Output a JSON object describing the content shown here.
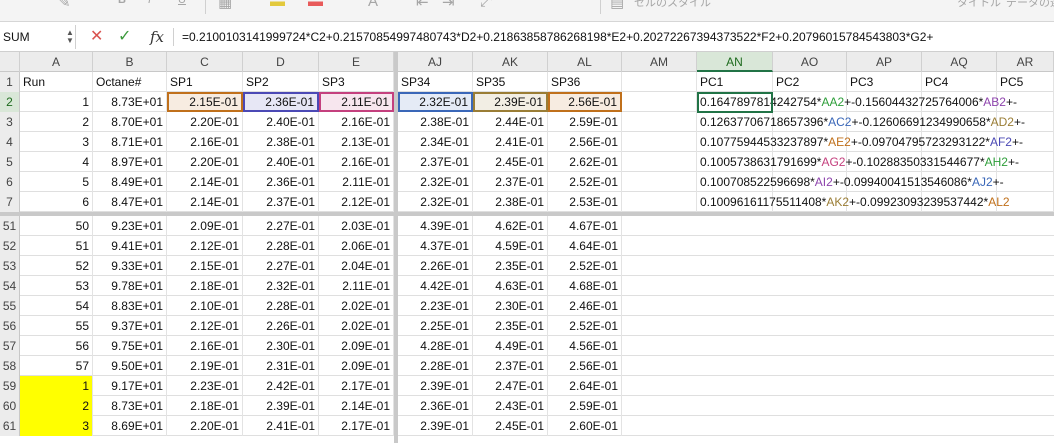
{
  "ribbon": {
    "cell_style_label": "セルのスタイル",
    "title_label": "タイトル",
    "data_label": "データの選"
  },
  "formula_bar": {
    "name_box": "SUM",
    "formula": "=0.2100103141999724*C2+0.21570854997480743*D2+0.21863858786268198*E2+0.20272267394373522*F2+0.20796015784543803*G2+"
  },
  "columns": [
    {
      "key": "A",
      "label": "A"
    },
    {
      "key": "B",
      "label": "B"
    },
    {
      "key": "C",
      "label": "C"
    },
    {
      "key": "D",
      "label": "D"
    },
    {
      "key": "E",
      "label": "E"
    },
    {
      "key": "AJ",
      "label": "AJ"
    },
    {
      "key": "AK",
      "label": "AK"
    },
    {
      "key": "AL",
      "label": "AL"
    },
    {
      "key": "AM",
      "label": "AM"
    },
    {
      "key": "AN",
      "label": "AN"
    },
    {
      "key": "AO",
      "label": "AO"
    },
    {
      "key": "AP",
      "label": "AP"
    },
    {
      "key": "AQ",
      "label": "AQ"
    },
    {
      "key": "AR",
      "label": "AR"
    }
  ],
  "ref_colors": {
    "C": "#c0701b",
    "D": "#4b49b5",
    "E": "#c4407e",
    "AJ": "#3a67b8",
    "AK": "#9a7d35",
    "AL": "#c0701b"
  },
  "top_rows": [
    {
      "num": "1",
      "cells": [
        "Run",
        "Octane#",
        "SP1",
        "SP2",
        "SP3",
        "SP34",
        "SP35",
        "SP36",
        "",
        "PC1",
        "PC2",
        "PC3",
        "PC4",
        "PC5"
      ]
    },
    {
      "num": "2",
      "cells": [
        "1",
        "8.73E+01",
        "2.15E-01",
        "2.36E-01",
        "2.11E-01",
        "2.32E-01",
        "2.39E-01",
        "2.56E-01",
        "",
        "",
        "",
        "",
        "",
        ""
      ],
      "pc": {
        "a": "0.1647897814242754*",
        "r1": "AA2",
        "b": "+-0.15604432725764006*",
        "r2": "AB2",
        "c": "+-",
        "c1": "#2e9e3a",
        "c2": "#8e44ad"
      }
    },
    {
      "num": "3",
      "cells": [
        "2",
        "8.70E+01",
        "2.20E-01",
        "2.40E-01",
        "2.16E-01",
        "2.38E-01",
        "2.44E-01",
        "2.59E-01",
        "",
        "",
        "",
        "",
        "",
        ""
      ],
      "pc": {
        "a": "0.12637706718657396*",
        "r1": "AC2",
        "b": "+-0.12606691234990658*",
        "r2": "AD2",
        "c": "+-",
        "c1": "#3a67b8",
        "c2": "#9a7d35"
      }
    },
    {
      "num": "4",
      "cells": [
        "3",
        "8.71E+01",
        "2.16E-01",
        "2.38E-01",
        "2.13E-01",
        "2.34E-01",
        "2.41E-01",
        "2.56E-01",
        "",
        "",
        "",
        "",
        "",
        ""
      ],
      "pc": {
        "a": "0.10775944533237897*",
        "r1": "AE2",
        "b": "+-0.09704795723293122*",
        "r2": "AF2",
        "c": "+-",
        "c1": "#c0701b",
        "c2": "#4b49b5"
      }
    },
    {
      "num": "5",
      "cells": [
        "4",
        "8.97E+01",
        "2.20E-01",
        "2.40E-01",
        "2.16E-01",
        "2.37E-01",
        "2.45E-01",
        "2.62E-01",
        "",
        "",
        "",
        "",
        "",
        ""
      ],
      "pc": {
        "a": "0.1005738631791699*",
        "r1": "AG2",
        "b": "+-0.10288350331544677*",
        "r2": "AH2",
        "c": "+-",
        "c1": "#c4407e",
        "c2": "#2e9e3a"
      }
    },
    {
      "num": "6",
      "cells": [
        "5",
        "8.49E+01",
        "2.14E-01",
        "2.36E-01",
        "2.11E-01",
        "2.32E-01",
        "2.37E-01",
        "2.52E-01",
        "",
        "",
        "",
        "",
        "",
        ""
      ],
      "pc": {
        "a": "0.100708522596698*",
        "r1": "AI2",
        "b": "+-0.09940041513546086*",
        "r2": "AJ2",
        "c": "+-",
        "c1": "#8e44ad",
        "c2": "#3a67b8"
      }
    },
    {
      "num": "7",
      "cells": [
        "6",
        "8.47E+01",
        "2.14E-01",
        "2.37E-01",
        "2.12E-01",
        "2.32E-01",
        "2.38E-01",
        "2.53E-01",
        "",
        "",
        "",
        "",
        "",
        ""
      ],
      "pc": {
        "a": "0.10096161175511408*",
        "r1": "AK2",
        "b": "+-0.09923093239537442*",
        "r2": "AL2",
        "c": "",
        "c1": "#9a7d35",
        "c2": "#c0701b"
      }
    }
  ],
  "bottom_rows": [
    {
      "num": "51",
      "cells": [
        "50",
        "9.23E+01",
        "2.09E-01",
        "2.27E-01",
        "2.03E-01",
        "4.39E-01",
        "4.62E-01",
        "4.67E-01"
      ]
    },
    {
      "num": "52",
      "cells": [
        "51",
        "9.41E+01",
        "2.12E-01",
        "2.28E-01",
        "2.06E-01",
        "4.37E-01",
        "4.59E-01",
        "4.64E-01"
      ]
    },
    {
      "num": "53",
      "cells": [
        "52",
        "9.33E+01",
        "2.15E-01",
        "2.27E-01",
        "2.04E-01",
        "2.26E-01",
        "2.35E-01",
        "2.52E-01"
      ]
    },
    {
      "num": "54",
      "cells": [
        "53",
        "9.78E+01",
        "2.18E-01",
        "2.32E-01",
        "2.11E-01",
        "4.42E-01",
        "4.63E-01",
        "4.68E-01"
      ]
    },
    {
      "num": "55",
      "cells": [
        "54",
        "8.83E+01",
        "2.10E-01",
        "2.28E-01",
        "2.02E-01",
        "2.23E-01",
        "2.30E-01",
        "2.46E-01"
      ]
    },
    {
      "num": "56",
      "cells": [
        "55",
        "9.37E+01",
        "2.12E-01",
        "2.26E-01",
        "2.02E-01",
        "2.25E-01",
        "2.35E-01",
        "2.52E-01"
      ]
    },
    {
      "num": "57",
      "cells": [
        "56",
        "9.75E+01",
        "2.16E-01",
        "2.30E-01",
        "2.09E-01",
        "4.28E-01",
        "4.49E-01",
        "4.56E-01"
      ]
    },
    {
      "num": "58",
      "cells": [
        "57",
        "9.50E+01",
        "2.19E-01",
        "2.31E-01",
        "2.09E-01",
        "2.28E-01",
        "2.37E-01",
        "2.56E-01"
      ]
    },
    {
      "num": "59",
      "cells": [
        "1",
        "9.17E+01",
        "2.23E-01",
        "2.42E-01",
        "2.17E-01",
        "2.39E-01",
        "2.47E-01",
        "2.64E-01"
      ],
      "yellow": true
    },
    {
      "num": "60",
      "cells": [
        "2",
        "8.73E+01",
        "2.18E-01",
        "2.39E-01",
        "2.14E-01",
        "2.36E-01",
        "2.43E-01",
        "2.59E-01"
      ],
      "yellow": true
    },
    {
      "num": "61",
      "cells": [
        "3",
        "8.69E+01",
        "2.20E-01",
        "2.41E-01",
        "2.17E-01",
        "2.39E-01",
        "2.45E-01",
        "2.60E-01"
      ],
      "yellow": true
    }
  ]
}
